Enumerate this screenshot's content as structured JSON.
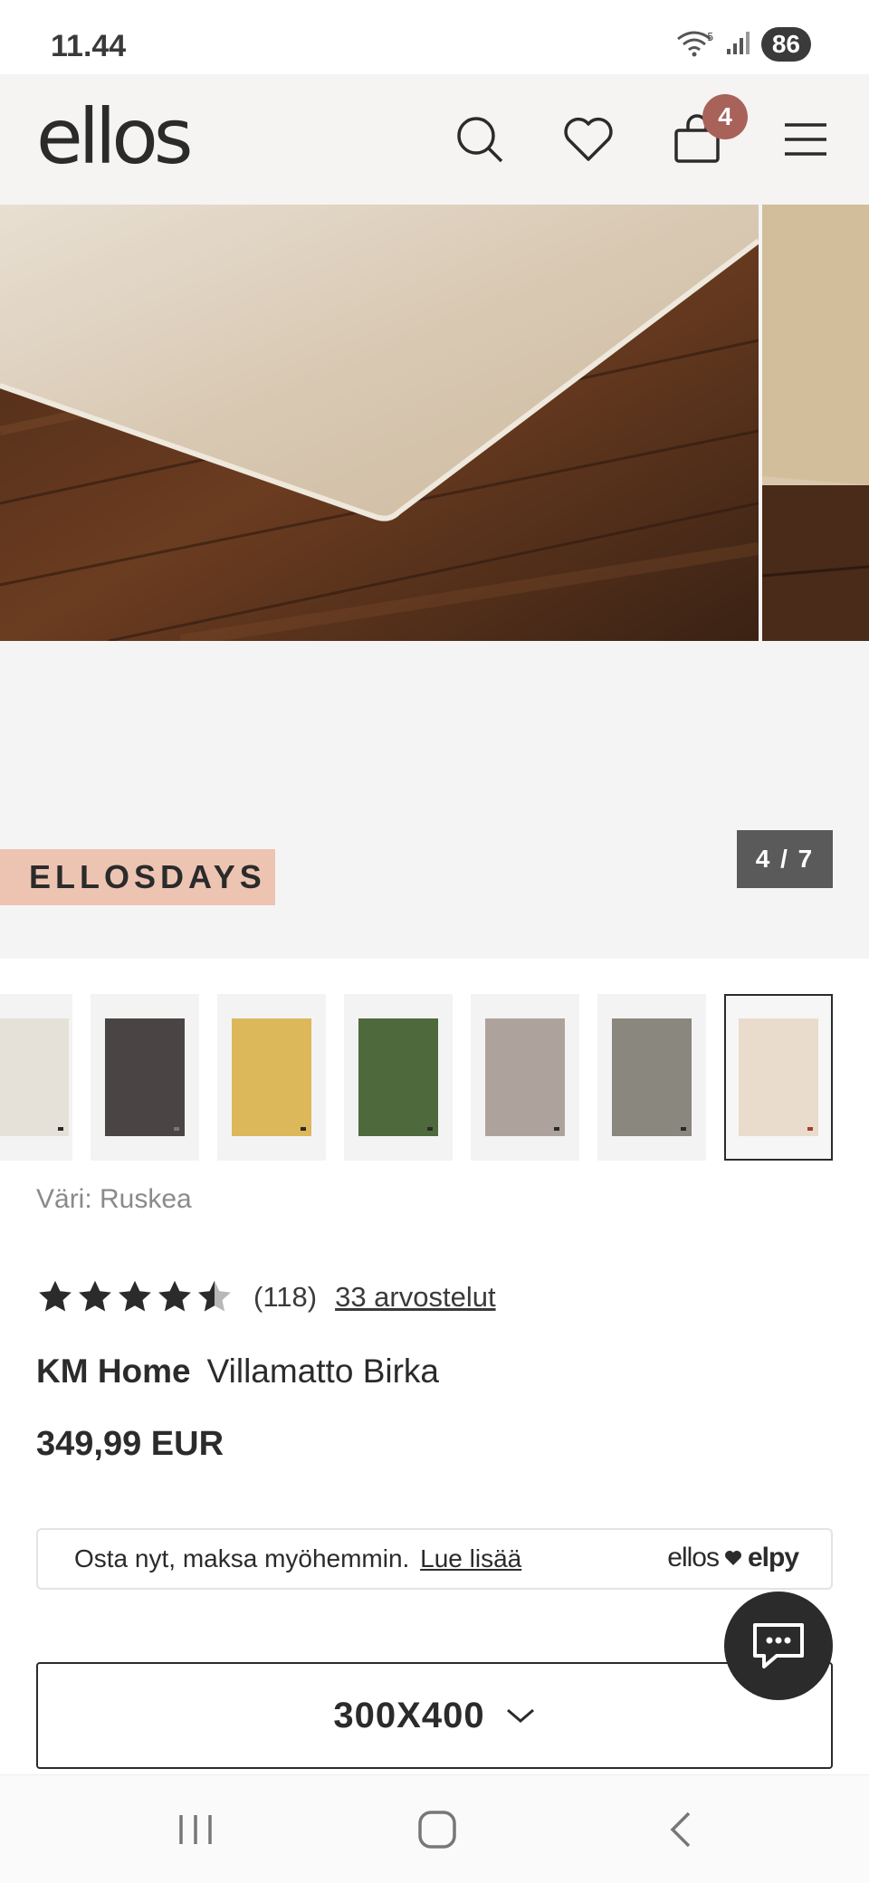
{
  "status_bar": {
    "time": "11.44",
    "battery": "86",
    "network_badge": "5"
  },
  "header": {
    "logo_text": "ellos",
    "cart_count": "4",
    "icons": [
      "search-icon",
      "heart-icon",
      "shopping-bag-icon",
      "hamburger-menu-icon"
    ]
  },
  "gallery": {
    "promo_tag": "ELLOSDAYS",
    "counter": "4 / 7",
    "current_index": 4,
    "total": 7
  },
  "thumbnails": [
    {
      "name": "thumb-1",
      "color": "#e5e1d9"
    },
    {
      "name": "thumb-2",
      "color": "#4a4544"
    },
    {
      "name": "thumb-3",
      "color": "#dcb85a"
    },
    {
      "name": "thumb-4",
      "color": "#4e6a3d"
    },
    {
      "name": "thumb-5",
      "color": "#aea39c"
    },
    {
      "name": "thumb-6",
      "color": "#8a877f"
    },
    {
      "name": "thumb-7",
      "color": "#e9dccc",
      "selected": true
    }
  ],
  "product": {
    "color_label": "Väri: Ruskea",
    "rating": 4.5,
    "rating_count": "(118)",
    "reviews_link": "33 arvostelut",
    "brand": "KM Home",
    "name": "Villamatto Birka",
    "price": "349,99 EUR"
  },
  "bnpl": {
    "text": "Osta nyt, maksa myöhemmin.",
    "link": "Lue lisää",
    "logo_left": "ellos",
    "logo_right": "elpy"
  },
  "size_selector": {
    "value": "300X400"
  },
  "colors": {
    "accent_badge": "#a8625a",
    "promo_bg": "#edc4b2",
    "dark": "#2b2b2b"
  }
}
